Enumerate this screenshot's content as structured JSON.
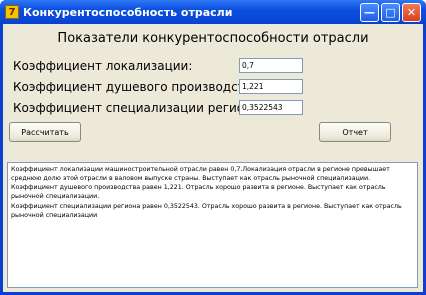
{
  "window": {
    "title": "Конкурентоспособность отрасли",
    "app_icon_letter": "7"
  },
  "form": {
    "heading": "Показатели конкурентоспособности отрасли",
    "rows": [
      {
        "label": "Коэффициент локализации:",
        "value": "0,7"
      },
      {
        "label": "Коэффициент душевого производства:",
        "value": "1,221"
      },
      {
        "label": "Коэффициент специализации региона:",
        "value": "0,3522543"
      }
    ],
    "calculate_label": "Рассчитать",
    "report_label": "Отчет"
  },
  "memo": {
    "lines": [
      "Коэффициент локализации машиностроительной отрасли равен 0,7.Локализация отрасли в регионе превышает среднюю долю этой отрасли в валовом выпуске страны. Выступает как отрасль рыночной специализации.",
      " Коэффициент душевого производства равен 1,221. Отрасль хорошо развита в регионе. Выступает как отрасль рыночной специализации.",
      " Коэффициент специализации региона равен 0,3522543. Отрасль хорошо развита в регионе. Выступает как отрасль рыночной специализации"
    ]
  }
}
